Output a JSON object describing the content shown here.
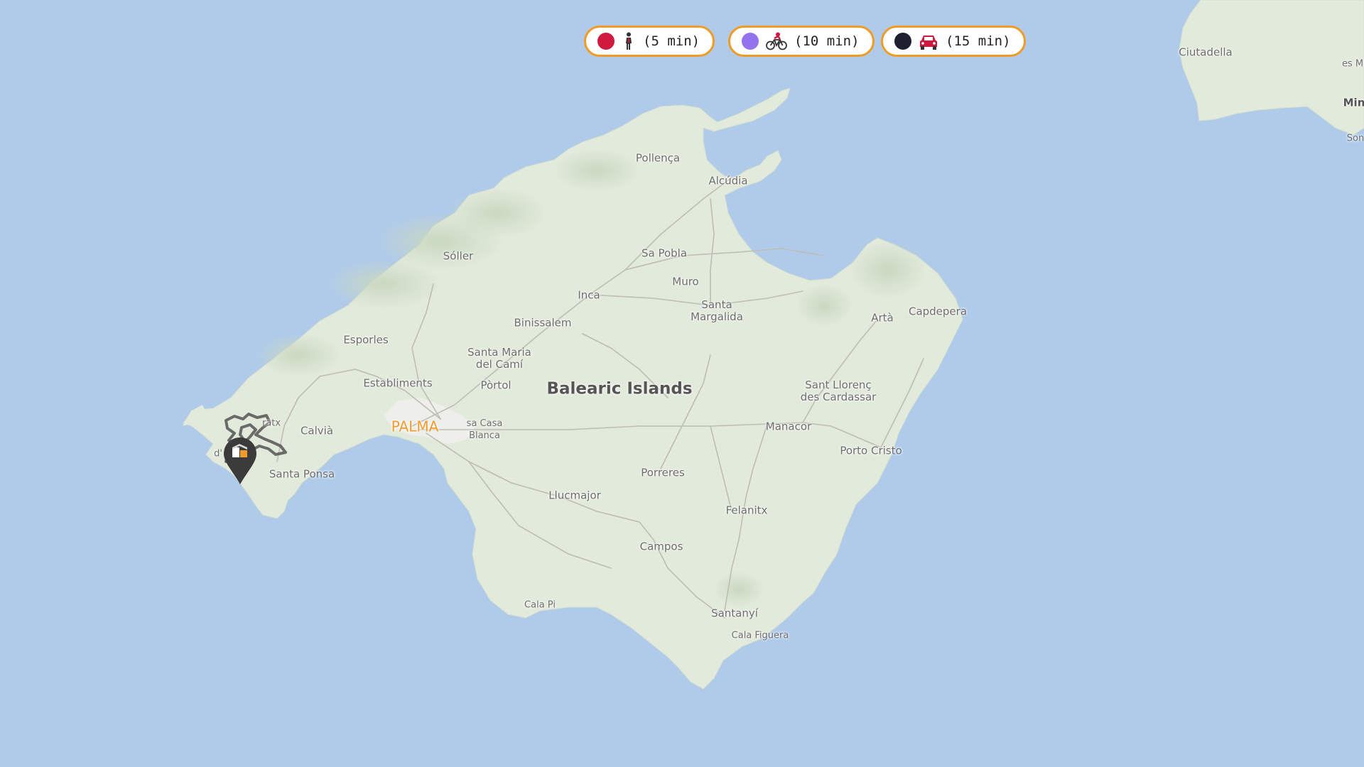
{
  "map": {
    "region_label": "Balearic Islands",
    "capital_label": "PALMA",
    "places": [
      {
        "id": "pollenca",
        "name": "Pollença"
      },
      {
        "id": "alcudia",
        "name": "Alcúdia"
      },
      {
        "id": "soller",
        "name": "Sóller"
      },
      {
        "id": "sa-pobla",
        "name": "Sa Pobla"
      },
      {
        "id": "muro",
        "name": "Muro"
      },
      {
        "id": "inca",
        "name": "Inca"
      },
      {
        "id": "santa-margalida",
        "name": "Santa\nMargalida"
      },
      {
        "id": "arta",
        "name": "Artà"
      },
      {
        "id": "capdepera",
        "name": "Capdepera"
      },
      {
        "id": "esporles",
        "name": "Esporles"
      },
      {
        "id": "binissalem",
        "name": "Binissalem"
      },
      {
        "id": "santa-maria",
        "name": "Santa Maria\ndel Camí"
      },
      {
        "id": "establiments",
        "name": "Establiments"
      },
      {
        "id": "portol",
        "name": "Pòrtol"
      },
      {
        "id": "sant-llorenc",
        "name": "Sant Llorenç\ndes Cardassar"
      },
      {
        "id": "calvia",
        "name": "Calvià"
      },
      {
        "id": "sa-casa-blanca",
        "name": "sa Casa\nBlanca"
      },
      {
        "id": "manacor",
        "name": "Manacor"
      },
      {
        "id": "santa-ponsa",
        "name": "Santa Ponsa"
      },
      {
        "id": "porto-cristo",
        "name": "Porto Cristo"
      },
      {
        "id": "porreres",
        "name": "Porreres"
      },
      {
        "id": "llucmajor",
        "name": "Llucmajor"
      },
      {
        "id": "felanitx",
        "name": "Felanitx"
      },
      {
        "id": "campos",
        "name": "Campos"
      },
      {
        "id": "cala-pi",
        "name": "Cala Pi"
      },
      {
        "id": "santanyi",
        "name": "Santanyí"
      },
      {
        "id": "cala-figuera",
        "name": "Cala Figuera"
      },
      {
        "id": "ciutadella",
        "name": "Ciutadella"
      },
      {
        "id": "es-m",
        "name": "es M"
      },
      {
        "id": "min",
        "name": "Min"
      },
      {
        "id": "son",
        "name": "Son"
      },
      {
        "id": "andratx",
        "name": "ratx"
      },
      {
        "id": "d-prefix",
        "name": "d'"
      }
    ]
  },
  "legend": [
    {
      "id": "walk",
      "mode_icon": "walking-person-icon",
      "label": "(5 min)",
      "color": "#d0193f"
    },
    {
      "id": "bike",
      "mode_icon": "bicycle-icon",
      "label": "(10 min)",
      "color": "#9474ec"
    },
    {
      "id": "car",
      "mode_icon": "car-icon",
      "label": "(15 min)",
      "color": "#1e2032"
    }
  ],
  "colors": {
    "sea": "#b0cbea",
    "land": "#e2eadb",
    "accent": "#ef9b24",
    "marker": "#3b3b3b"
  }
}
